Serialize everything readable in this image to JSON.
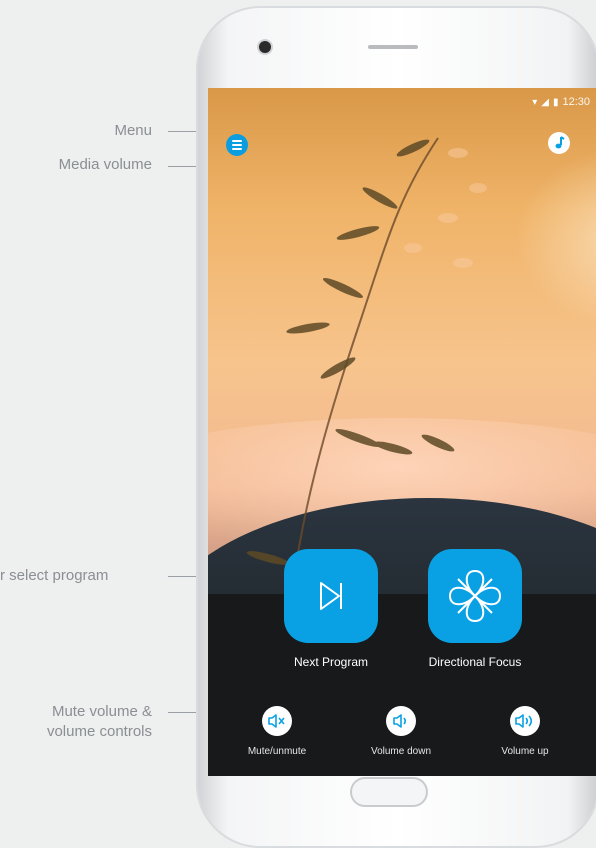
{
  "callouts": {
    "menu": "Menu",
    "media_volume": "Media volume",
    "select_program": "r select program",
    "mute_line1": "Mute volume &",
    "mute_line2": "volume controls"
  },
  "status_bar": {
    "time": "12:30"
  },
  "main_buttons": {
    "next_program": "Next Program",
    "directional_focus": "Directional Focus"
  },
  "volume_controls": {
    "mute": "Mute/unmute",
    "down": "Volume down",
    "up": "Volume up"
  },
  "icons": {
    "menu": "hamburger-icon",
    "media_volume": "music-note-icon",
    "next_program": "skip-next-icon",
    "directional_focus": "clover-focus-icon",
    "mute": "speaker-mute-icon",
    "down": "speaker-low-icon",
    "up": "speaker-high-icon"
  },
  "colors": {
    "accent": "#0aa1e4",
    "callout_text": "#8a8f94"
  }
}
